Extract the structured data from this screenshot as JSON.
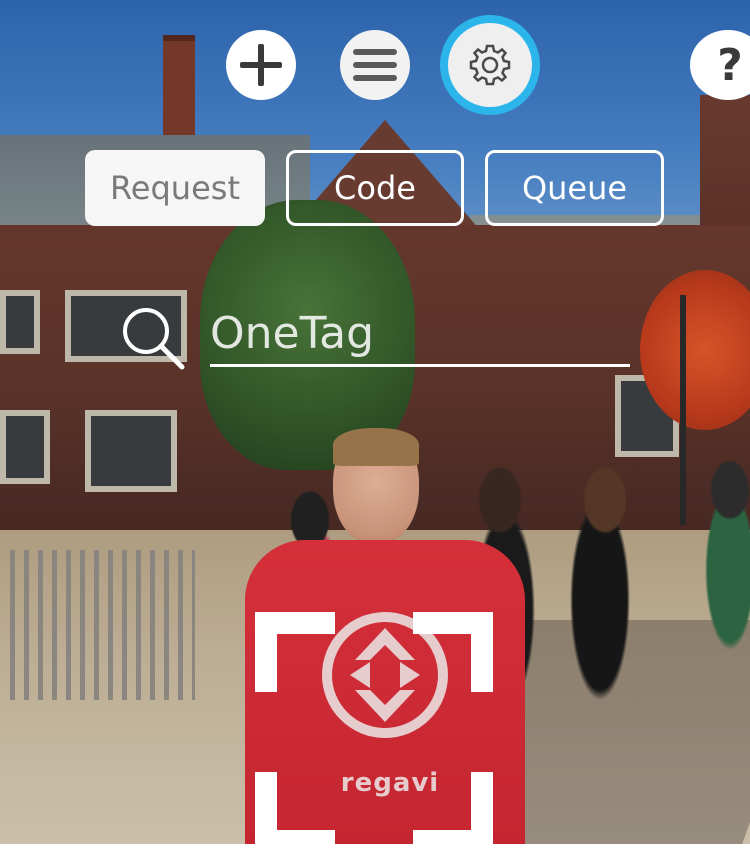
{
  "toolbar": {
    "add_icon": "plus-icon",
    "menu_icon": "hamburger-menu-icon",
    "settings_icon": "gear-icon",
    "help_label": "?",
    "active_color": "#2cb5ea"
  },
  "mode_tabs": [
    {
      "label": "Request",
      "selected": true
    },
    {
      "label": "Code",
      "selected": false
    },
    {
      "label": "Queue",
      "selected": false
    }
  ],
  "search": {
    "icon": "search-icon",
    "placeholder": "OneTag",
    "value": ""
  },
  "camera": {
    "shirt_text": "regavi",
    "scan_frame_color": "#ffffff"
  }
}
